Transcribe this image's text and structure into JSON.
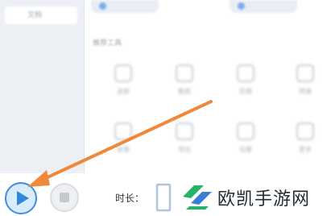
{
  "sidebar": {
    "items": [
      {
        "label": "文档"
      }
    ]
  },
  "main": {
    "section_label": "推荐工具",
    "items": [
      {
        "label": "录屏"
      },
      {
        "label": "截图"
      },
      {
        "label": "剪辑"
      },
      {
        "label": "转换"
      },
      {
        "label": "录像"
      },
      {
        "label": "导出"
      },
      {
        "label": "设置"
      },
      {
        "label": "更多"
      }
    ]
  },
  "footer": {
    "duration_label": "时长：",
    "duration_value": ""
  },
  "watermark": {
    "text": "欧凯手游网"
  },
  "colors": {
    "accent": "#3d8ee0",
    "arrow": "#f0883a",
    "watermark_green": "#20b46a"
  },
  "icons": {
    "play": "play-icon",
    "stop": "stop-icon"
  }
}
